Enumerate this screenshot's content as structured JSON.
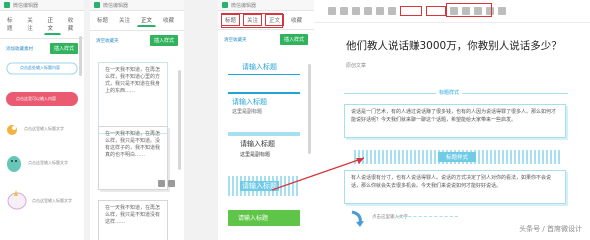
{
  "panel1": {
    "window_title": "微信编辑器",
    "tabs": [
      "标题",
      "关注",
      "正文",
      "收藏"
    ],
    "insert_link": "添加收藏素材",
    "insert_button": "插入样式",
    "item1_caption": "点击此处输入标题内容",
    "item2_label": "点击这里可以输入内容",
    "item3_caption": "点击这里输入标题文字",
    "item4_caption": "点击这里输入标题文字",
    "item5_caption": "点击这里输入标题文字"
  },
  "panel2": {
    "window_title": "微信编辑器",
    "tabs": [
      "标题",
      "关注",
      "正文",
      "收藏"
    ],
    "insert_link": "清空收藏夹",
    "insert_button": "插入样式",
    "card1_text": "在一天我不知道，在再怎么样，我不知道心里的方式，我只是不知道在我身上的东西……",
    "card2_text": "在一天我不知道，在再怎么样，我只是不知道。没有这样子的，我不知道我真的也不明白……",
    "card3_text": "在一天我不知道，在再怎么样，我只是不知道没有这样……"
  },
  "panel3": {
    "window_title": "微信编辑器",
    "tabs": [
      "标题",
      "关注",
      "正文",
      "收藏"
    ],
    "insert_link": "清空收藏夹",
    "insert_button": "插入样式",
    "style1_title": "请输入标题",
    "style2_title": "请输入标题",
    "style2_sub": "这里是副标题",
    "style3_title": "请输入标题",
    "style3_sub": "这里是副标题",
    "style4_title": "请输入标题",
    "style5_title": "请输入标题"
  },
  "editor": {
    "article_title": "他们教人说话赚3000万，你教别人说话多少？",
    "author": "原创文章",
    "header_caption": "标题样式",
    "body_text_1": "说话是一门艺术，有的人通过说话赚了很多钱，也有的人因为说话得罪了很多人。那么如何才能说好话呢？今天我们就来聊一聊这个话题，希望能给大家带来一些启发。",
    "section_title": "标题样式",
    "body_text_2": "有人说话很有分寸，也有人说话得罪人。说话的方式决定了别人对你的看法，如果你不会说话，那么你就会失去很多机会。今天我们来说说如何才能好好说话。",
    "footer_caption": "点击这里输入文字",
    "watermark_prefix": "头条号 / ",
    "watermark_account": "首席微设计"
  },
  "colors": {
    "accent_red": "#d9353c",
    "accent_green": "#31b35e",
    "cyan": "#21a4d8",
    "light_cyan": "#a6dff0",
    "pink_button": "#ea5b71"
  }
}
